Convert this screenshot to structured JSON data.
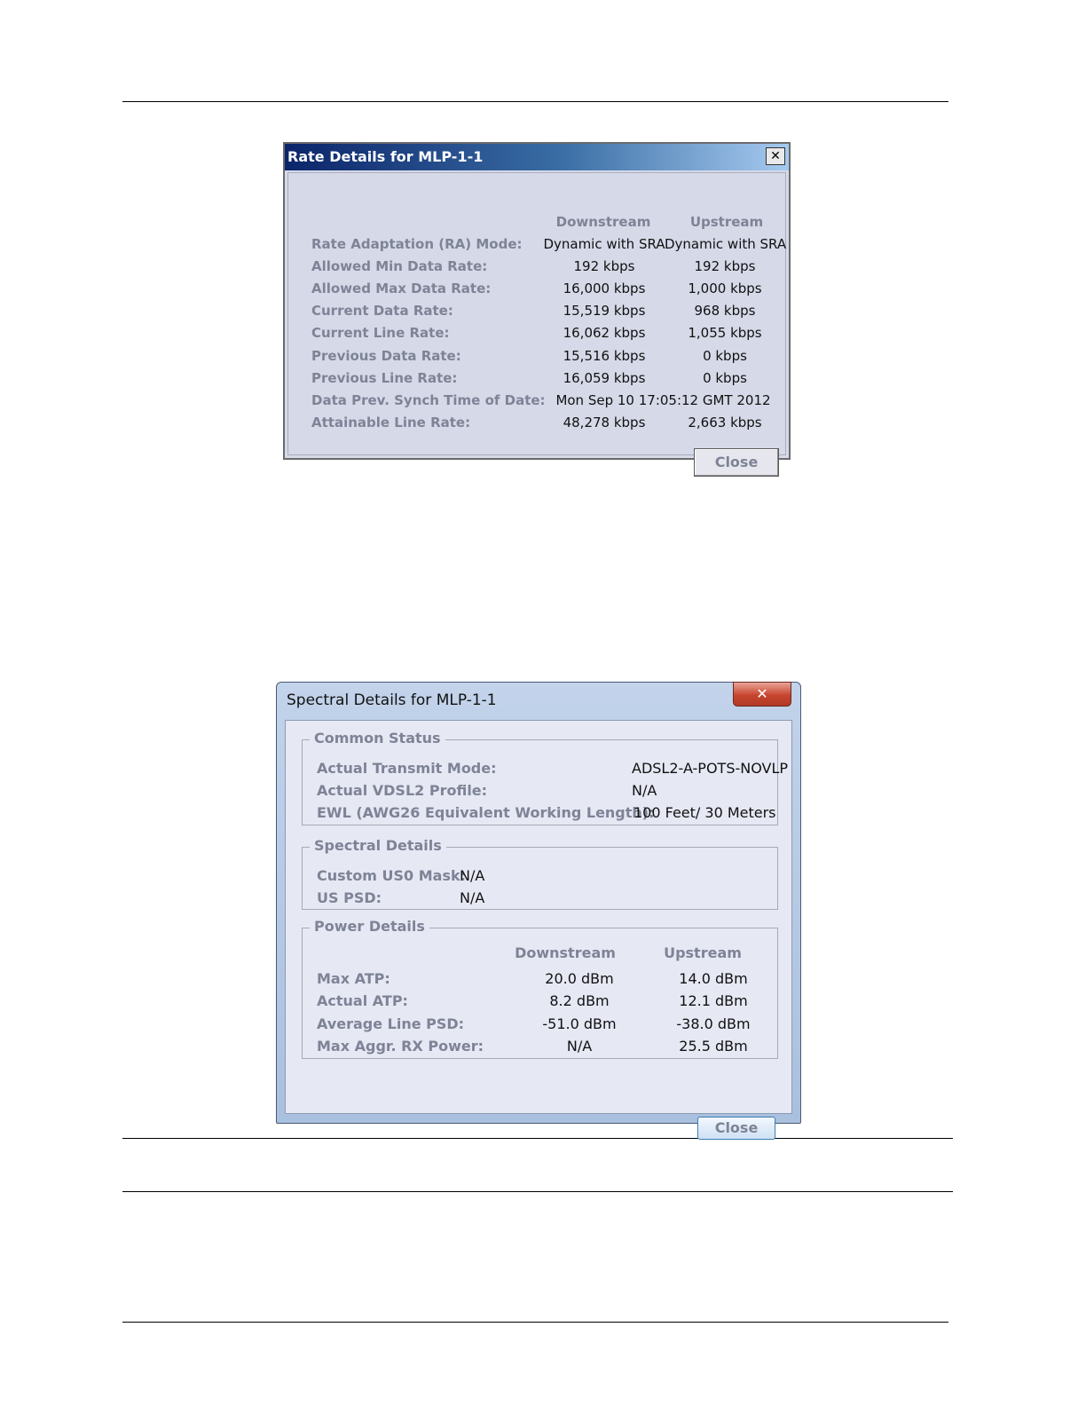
{
  "rate_dialog": {
    "title": "Rate Details for MLP-1-1",
    "close_x": "✕",
    "col_downstream": "Downstream",
    "col_upstream": "Upstream",
    "rows": [
      {
        "label": "Rate Adaptation (RA) Mode:",
        "down": "Dynamic with SRA",
        "up": "Dynamic with SRA"
      },
      {
        "label": "Allowed Min Data Rate:",
        "down": "192 kbps",
        "up": "192 kbps"
      },
      {
        "label": "Allowed Max Data Rate:",
        "down": "16,000 kbps",
        "up": "1,000 kbps"
      },
      {
        "label": "Current Data Rate:",
        "down": "15,519 kbps",
        "up": "968 kbps"
      },
      {
        "label": "Current Line Rate:",
        "down": "16,062 kbps",
        "up": "1,055 kbps"
      },
      {
        "label": "Previous Data Rate:",
        "down": "15,516 kbps",
        "up": "0 kbps"
      },
      {
        "label": "Previous Line Rate:",
        "down": "16,059 kbps",
        "up": "0 kbps"
      },
      {
        "label": "Data Prev. Synch Time of Date:",
        "value": "Mon Sep 10 17:05:12 GMT 2012"
      },
      {
        "label": "Attainable Line Rate:",
        "down": "48,278 kbps",
        "up": "2,663 kbps"
      }
    ],
    "close_label": "Close"
  },
  "spectral_dialog": {
    "title": "Spectral Details for MLP-1-1",
    "close_x": "✕",
    "common_status": {
      "title": "Common Status",
      "rows": [
        {
          "label": "Actual Transmit Mode:",
          "value": "ADSL2-A-POTS-NOVLP"
        },
        {
          "label": "Actual VDSL2 Profile:",
          "value": "N/A"
        },
        {
          "label": "EWL (AWG26 Equivalent Working Length):",
          "value": "100 Feet/ 30 Meters"
        }
      ]
    },
    "spectral_details": {
      "title": "Spectral Details",
      "rows": [
        {
          "label": "Custom US0 Mask:",
          "value": "N/A"
        },
        {
          "label": "US PSD:",
          "value": "N/A"
        }
      ]
    },
    "power_details": {
      "title": "Power Details",
      "col_downstream": "Downstream",
      "col_upstream": "Upstream",
      "rows": [
        {
          "label": "Max ATP:",
          "down": "20.0 dBm",
          "up": "14.0 dBm"
        },
        {
          "label": "Actual ATP:",
          "down": "8.2 dBm",
          "up": "12.1 dBm"
        },
        {
          "label": "Average Line PSD:",
          "down": "-51.0 dBm",
          "up": "-38.0 dBm"
        },
        {
          "label": "Max Aggr. RX Power:",
          "down": "N/A",
          "up": "25.5 dBm"
        }
      ]
    },
    "close_label": "Close"
  }
}
